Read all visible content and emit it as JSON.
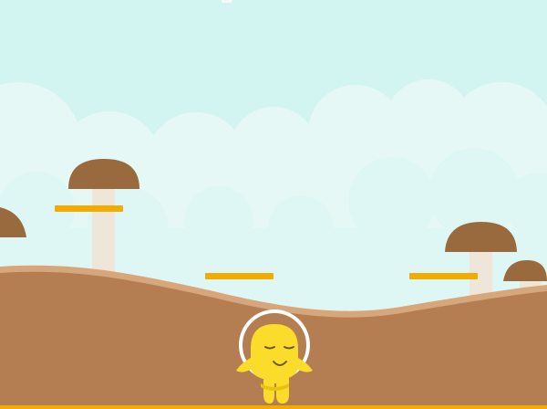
{
  "colors": {
    "sky": "#d3f5f1",
    "cloud": "#e6f8f6",
    "cloud_far": "#ddf5f2",
    "ground": "#b57d52",
    "ground_edge": "#d7a67a",
    "mushroom_cap": "#9a6a3f",
    "mushroom_stem": "#efe6da",
    "platform": "#f2ab00",
    "player_body": "#fbdc2a",
    "player_shade": "#e8c20f",
    "player_ring": "#ffffff"
  },
  "scene": {
    "player": {
      "state": "sleeping",
      "icon": "yellow-blob-character-icon"
    },
    "platforms": [
      {
        "id": "left-platform"
      },
      {
        "id": "center-platform"
      },
      {
        "id": "right-platform"
      }
    ],
    "mushrooms": [
      {
        "id": "far-left-mushroom"
      },
      {
        "id": "left-mushroom"
      },
      {
        "id": "right-mushroom"
      },
      {
        "id": "far-right-mushroom"
      }
    ]
  }
}
